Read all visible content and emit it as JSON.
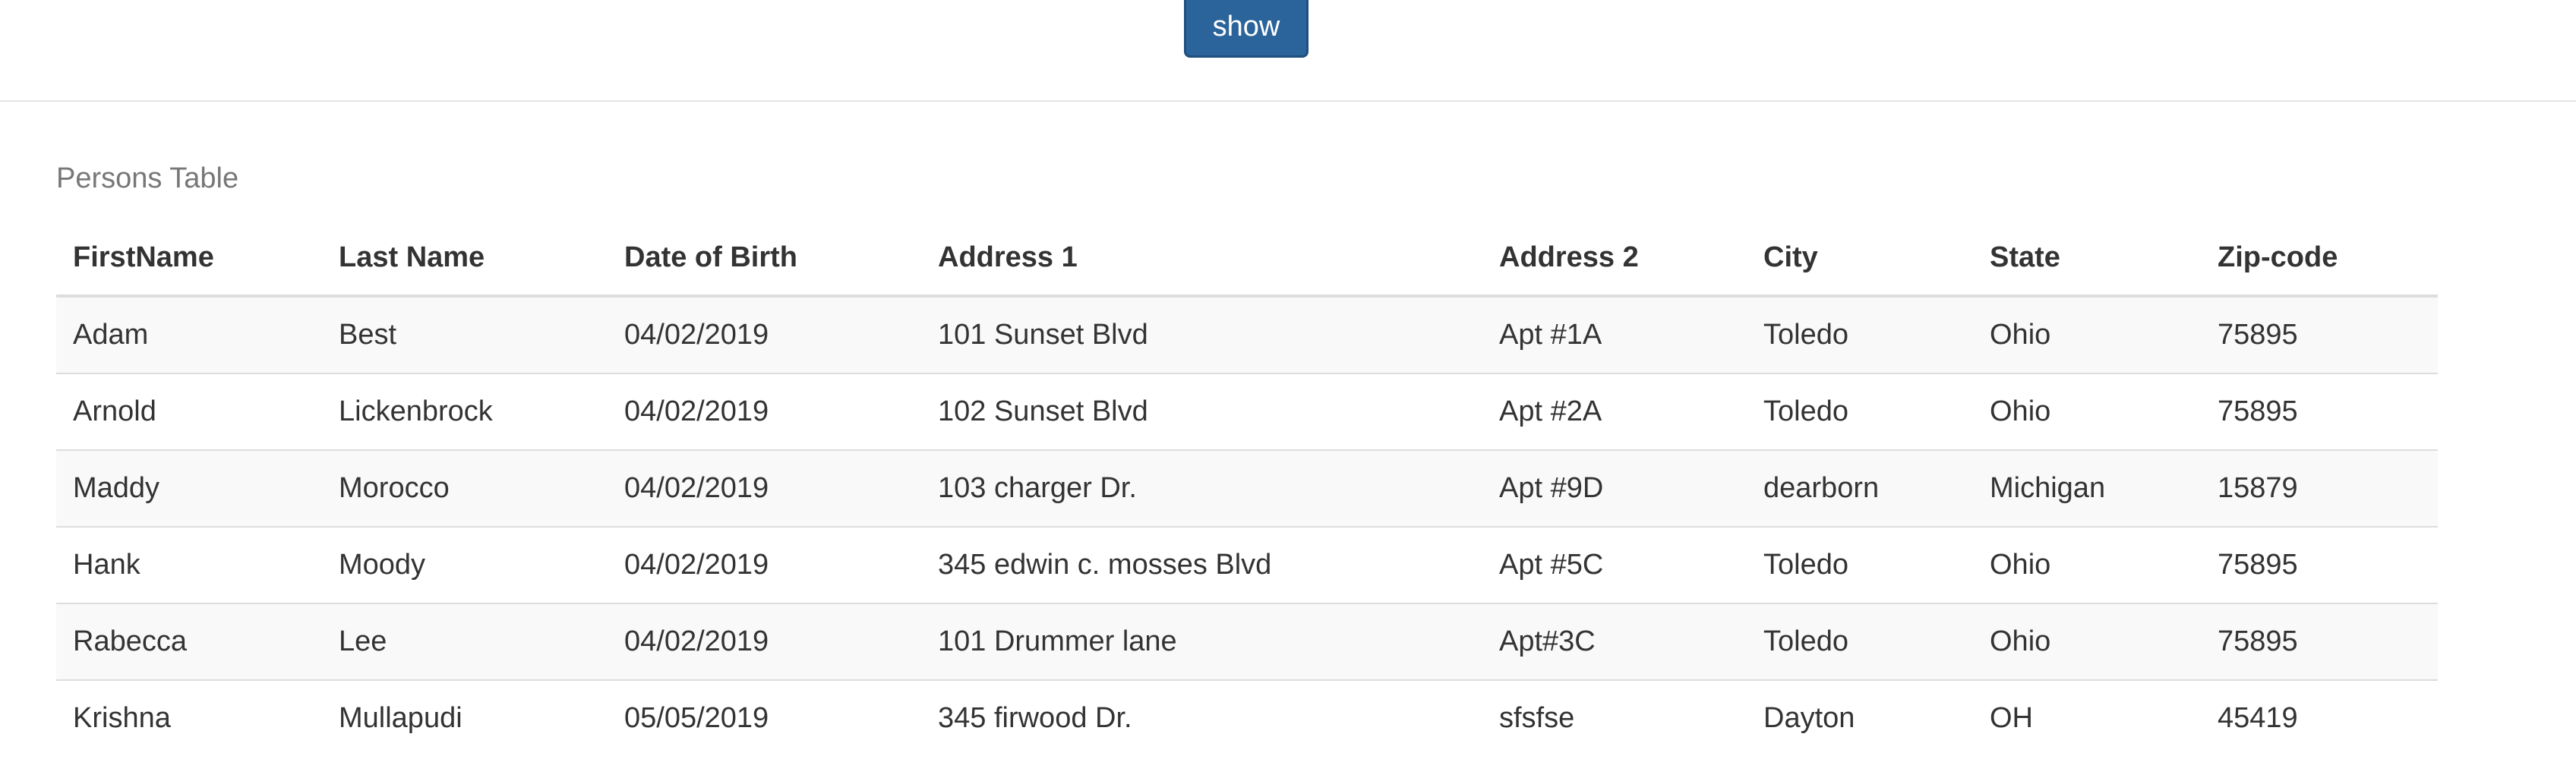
{
  "toolbar": {
    "show_label": "show",
    "button_color": "#2b649a"
  },
  "table": {
    "caption": "Persons Table",
    "headers": [
      "FirstName",
      "Last Name",
      "Date of Birth",
      "Address 1",
      "Address 2",
      "City",
      "State",
      "Zip-code"
    ],
    "rows": [
      [
        "Adam",
        "Best",
        "04/02/2019",
        "101 Sunset Blvd",
        "Apt #1A",
        "Toledo",
        "Ohio",
        "75895"
      ],
      [
        "Arnold",
        "Lickenbrock",
        "04/02/2019",
        "102 Sunset Blvd",
        "Apt #2A",
        "Toledo",
        "Ohio",
        "75895"
      ],
      [
        "Maddy",
        "Morocco",
        "04/02/2019",
        "103 charger Dr.",
        "Apt #9D",
        "dearborn",
        "Michigan",
        "15879"
      ],
      [
        "Hank",
        "Moody",
        "04/02/2019",
        "345 edwin c. mosses Blvd",
        "Apt #5C",
        "Toledo",
        "Ohio",
        "75895"
      ],
      [
        "Rabecca",
        "Lee",
        "04/02/2019",
        "101 Drummer lane",
        "Apt#3C",
        "Toledo",
        "Ohio",
        "75895"
      ],
      [
        "Krishna",
        "Mullapudi",
        "05/05/2019",
        "345 firwood Dr.",
        "sfsfse",
        "Dayton",
        "OH",
        "45419"
      ]
    ]
  }
}
